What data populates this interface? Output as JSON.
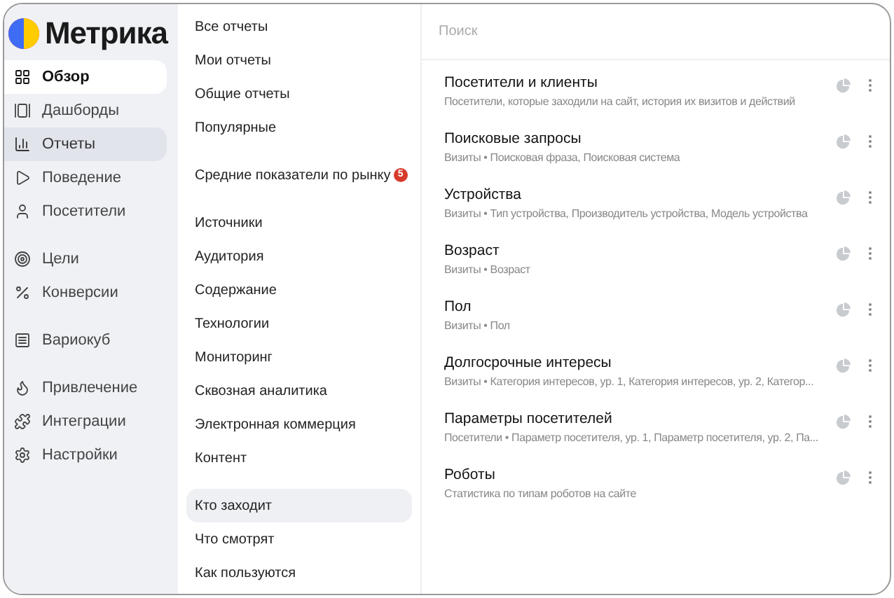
{
  "logo": {
    "text": "Метрика"
  },
  "sidebar": {
    "groups": [
      [
        {
          "label": "Обзор",
          "selected": false,
          "hovered": true
        },
        {
          "label": "Дашборды",
          "selected": false,
          "hovered": false
        },
        {
          "label": "Отчеты",
          "selected": true,
          "hovered": false
        },
        {
          "label": "Поведение",
          "selected": false,
          "hovered": false
        },
        {
          "label": "Посетители",
          "selected": false,
          "hovered": false
        }
      ],
      [
        {
          "label": "Цели",
          "selected": false,
          "hovered": false
        },
        {
          "label": "Конверсии",
          "selected": false,
          "hovered": false
        }
      ],
      [
        {
          "label": "Вариокуб",
          "selected": false,
          "hovered": false
        }
      ],
      [
        {
          "label": "Привлечение",
          "selected": false,
          "hovered": false
        },
        {
          "label": "Интеграции",
          "selected": false,
          "hovered": false
        },
        {
          "label": "Настройки",
          "selected": false,
          "hovered": false
        }
      ]
    ]
  },
  "reports_menu": {
    "groups": [
      [
        {
          "label": "Все отчеты",
          "selected": false
        },
        {
          "label": "Мои отчеты",
          "selected": false
        },
        {
          "label": "Общие отчеты",
          "selected": false
        },
        {
          "label": "Популярные",
          "selected": false
        }
      ],
      [
        {
          "label": "Средние показатели по рынку",
          "badge": "5",
          "selected": false
        }
      ],
      [
        {
          "label": "Источники",
          "selected": false
        },
        {
          "label": "Аудитория",
          "selected": false
        },
        {
          "label": "Содержание",
          "selected": false
        },
        {
          "label": "Технологии",
          "selected": false
        },
        {
          "label": "Мониторинг",
          "selected": false
        },
        {
          "label": "Сквозная аналитика",
          "selected": false
        },
        {
          "label": "Электронная коммерция",
          "selected": false
        },
        {
          "label": "Контент",
          "selected": false
        }
      ],
      [
        {
          "label": "Кто заходит",
          "selected": true
        },
        {
          "label": "Что смотрят",
          "selected": false
        },
        {
          "label": "Как пользуются",
          "selected": false
        }
      ]
    ]
  },
  "search": {
    "placeholder": "Поиск"
  },
  "reports": [
    {
      "title": "Посетители и клиенты",
      "description": "Посетители, которые заходили на сайт, история их визитов и действий"
    },
    {
      "title": "Поисковые запросы",
      "description": "Визиты • Поисковая фраза, Поисковая система"
    },
    {
      "title": "Устройства",
      "description": "Визиты • Тип устройства, Производитель устройства, Модель устройства"
    },
    {
      "title": "Возраст",
      "description": "Визиты • Возраст"
    },
    {
      "title": "Пол",
      "description": "Визиты • Пол"
    },
    {
      "title": "Долгосрочные интересы",
      "description": "Визиты • Категория интересов, ур. 1, Категория интересов, ур. 2, Категор..."
    },
    {
      "title": "Параметры посетителей",
      "description": "Посетители • Параметр посетителя, ур. 1, Параметр посетителя, ур. 2, Па..."
    },
    {
      "title": "Роботы",
      "description": "Статистика по типам роботов на сайте"
    }
  ]
}
